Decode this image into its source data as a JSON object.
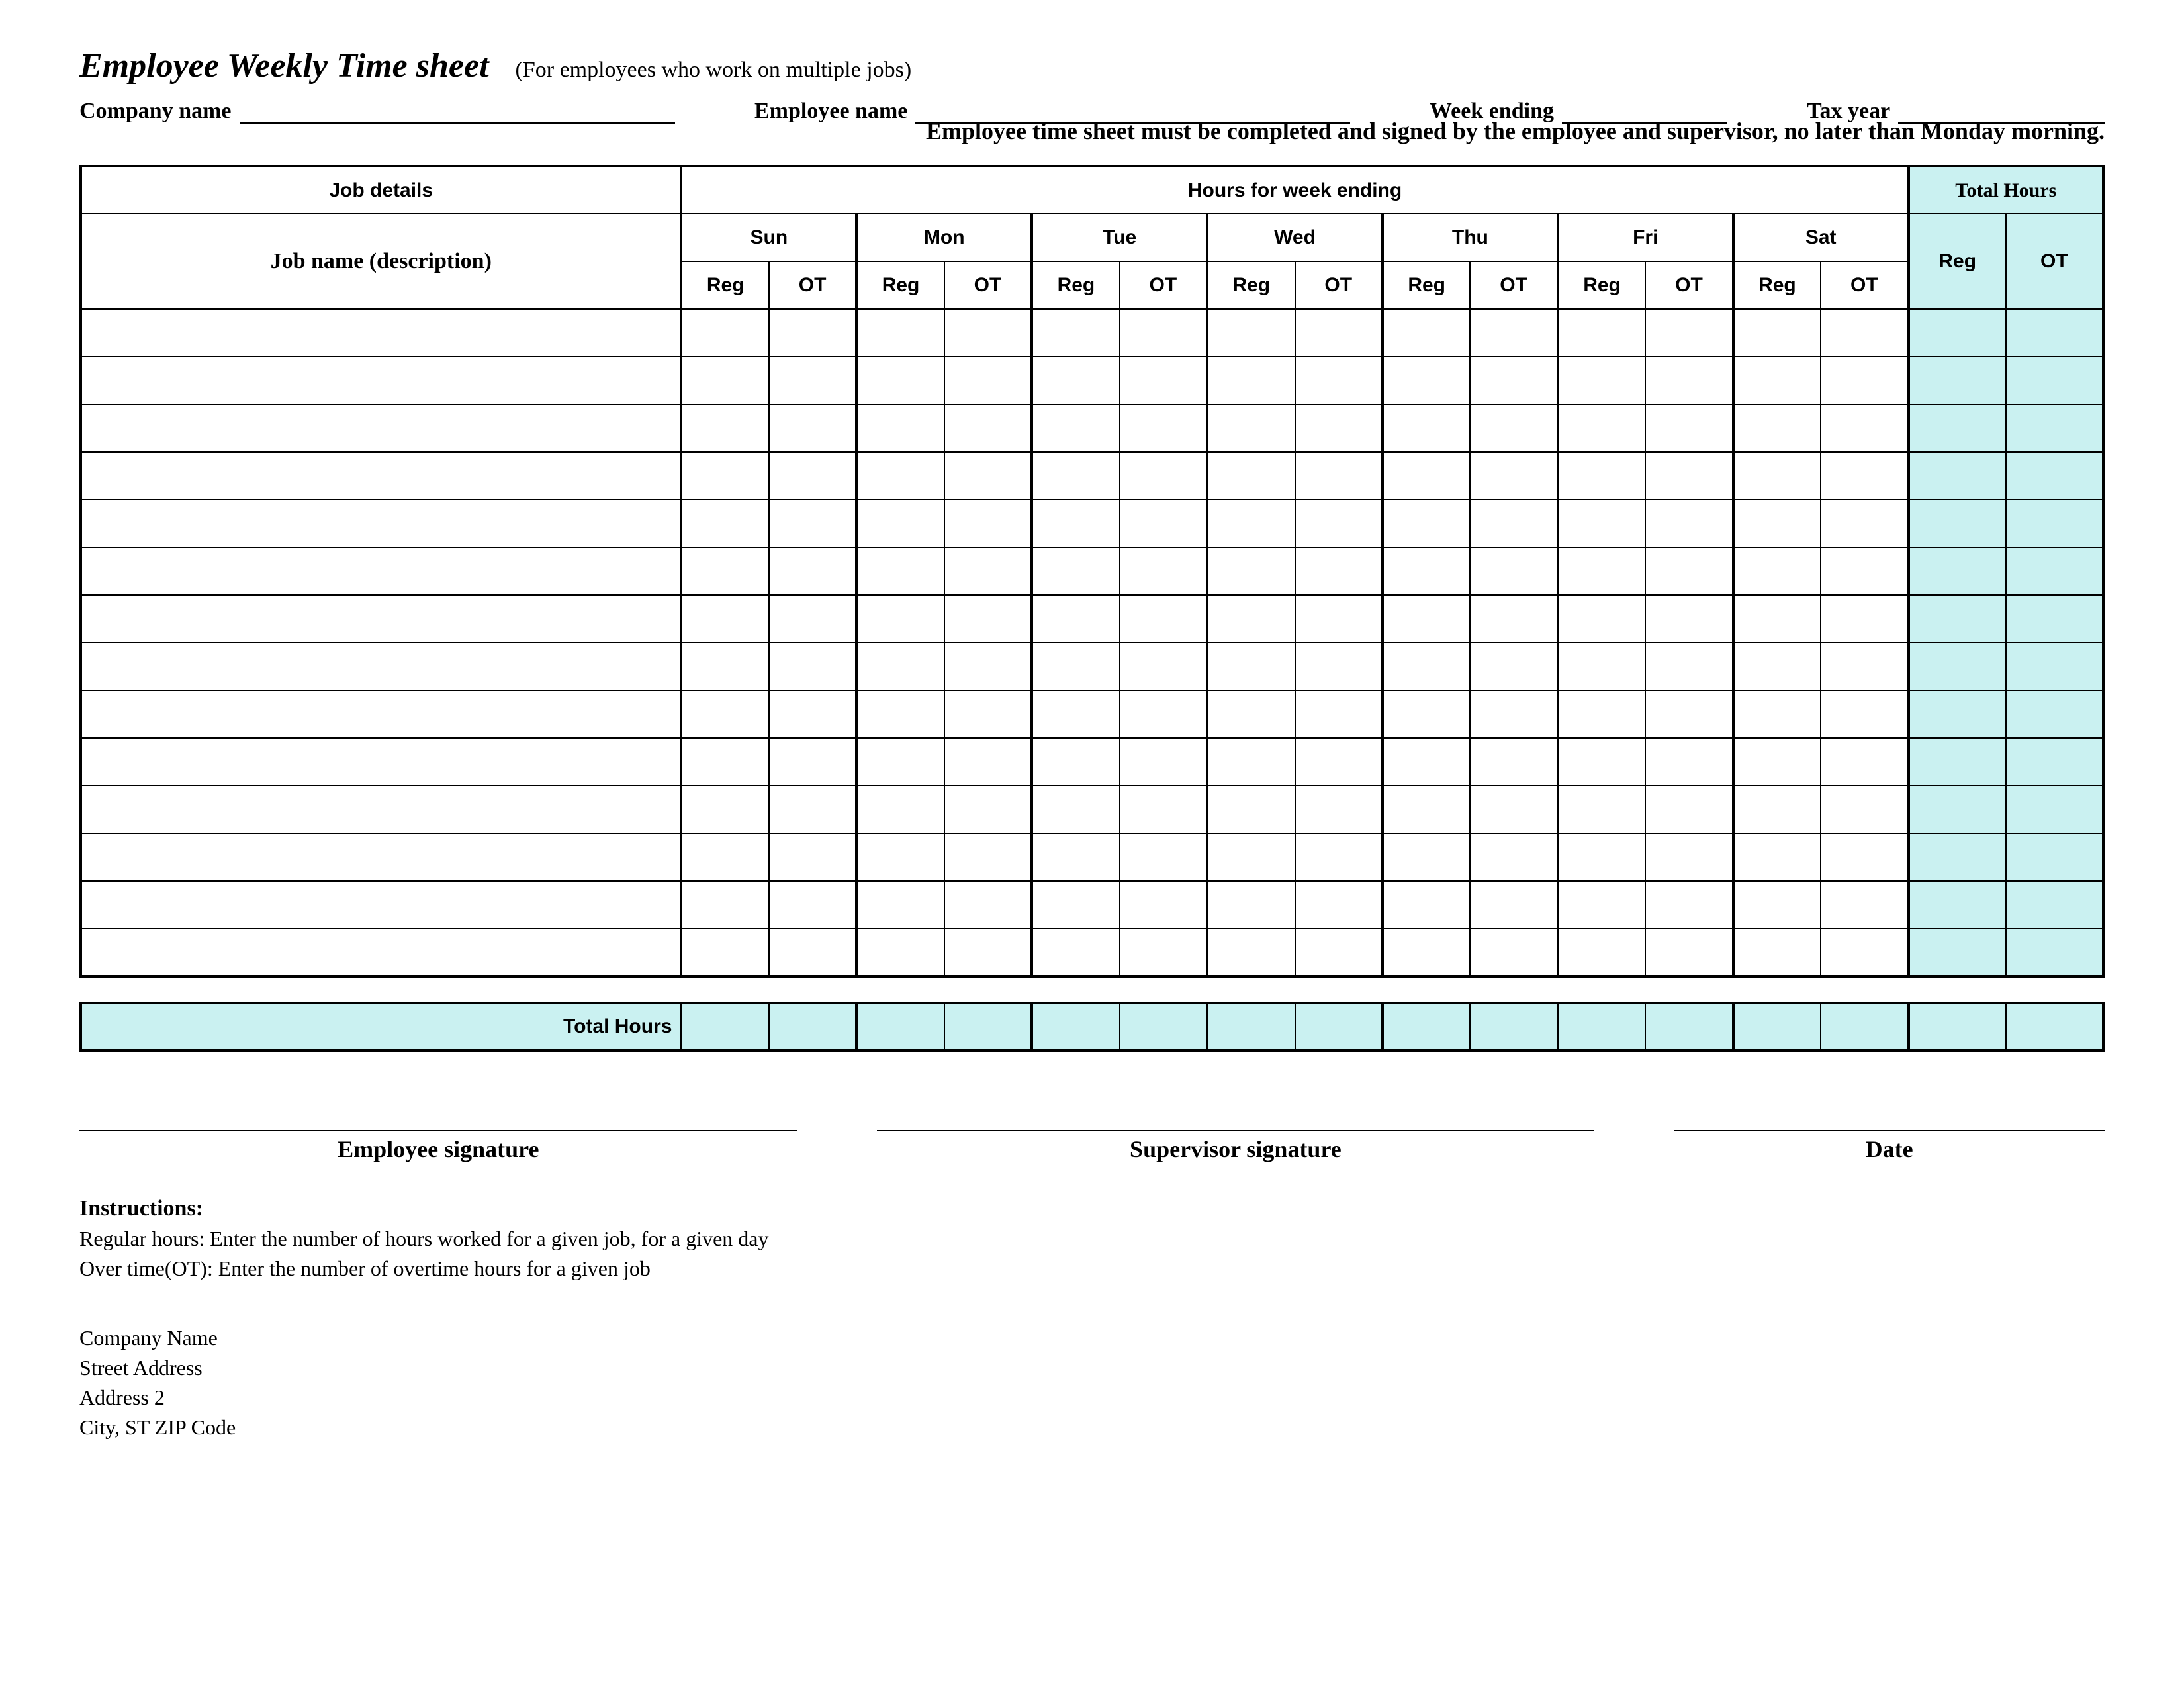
{
  "header": {
    "title": "Employee Weekly Time sheet",
    "subtitle": "(For employees who work on multiple jobs)",
    "company_label": "Company name",
    "employee_label": "Employee name",
    "week_ending_label": "Week ending",
    "tax_year_label": "Tax year",
    "bold_note": "Employee time sheet must be completed and signed by the employee and supervisor, no later than Monday morning."
  },
  "table": {
    "job_details_header": "Job details",
    "hours_for_week_header": "Hours for week ending",
    "total_hours_header": "Total Hours",
    "job_description_header": "Job name (description)",
    "reg_label": "Reg",
    "ot_label": "OT",
    "total_hours_row_label": "Total Hours",
    "days": [
      "Sun",
      "Mon",
      "Tue",
      "Wed",
      "Thu",
      "Fri",
      "Sat"
    ],
    "rows": [
      {
        "job": "",
        "cells": [
          "",
          "",
          "",
          "",
          "",
          "",
          "",
          "",
          "",
          "",
          "",
          "",
          "",
          ""
        ],
        "total_reg": "",
        "total_ot": ""
      },
      {
        "job": "",
        "cells": [
          "",
          "",
          "",
          "",
          "",
          "",
          "",
          "",
          "",
          "",
          "",
          "",
          "",
          ""
        ],
        "total_reg": "",
        "total_ot": ""
      },
      {
        "job": "",
        "cells": [
          "",
          "",
          "",
          "",
          "",
          "",
          "",
          "",
          "",
          "",
          "",
          "",
          "",
          ""
        ],
        "total_reg": "",
        "total_ot": ""
      },
      {
        "job": "",
        "cells": [
          "",
          "",
          "",
          "",
          "",
          "",
          "",
          "",
          "",
          "",
          "",
          "",
          "",
          ""
        ],
        "total_reg": "",
        "total_ot": ""
      },
      {
        "job": "",
        "cells": [
          "",
          "",
          "",
          "",
          "",
          "",
          "",
          "",
          "",
          "",
          "",
          "",
          "",
          ""
        ],
        "total_reg": "",
        "total_ot": ""
      },
      {
        "job": "",
        "cells": [
          "",
          "",
          "",
          "",
          "",
          "",
          "",
          "",
          "",
          "",
          "",
          "",
          "",
          ""
        ],
        "total_reg": "",
        "total_ot": ""
      },
      {
        "job": "",
        "cells": [
          "",
          "",
          "",
          "",
          "",
          "",
          "",
          "",
          "",
          "",
          "",
          "",
          "",
          ""
        ],
        "total_reg": "",
        "total_ot": ""
      },
      {
        "job": "",
        "cells": [
          "",
          "",
          "",
          "",
          "",
          "",
          "",
          "",
          "",
          "",
          "",
          "",
          "",
          ""
        ],
        "total_reg": "",
        "total_ot": ""
      },
      {
        "job": "",
        "cells": [
          "",
          "",
          "",
          "",
          "",
          "",
          "",
          "",
          "",
          "",
          "",
          "",
          "",
          ""
        ],
        "total_reg": "",
        "total_ot": ""
      },
      {
        "job": "",
        "cells": [
          "",
          "",
          "",
          "",
          "",
          "",
          "",
          "",
          "",
          "",
          "",
          "",
          "",
          ""
        ],
        "total_reg": "",
        "total_ot": ""
      },
      {
        "job": "",
        "cells": [
          "",
          "",
          "",
          "",
          "",
          "",
          "",
          "",
          "",
          "",
          "",
          "",
          "",
          ""
        ],
        "total_reg": "",
        "total_ot": ""
      },
      {
        "job": "",
        "cells": [
          "",
          "",
          "",
          "",
          "",
          "",
          "",
          "",
          "",
          "",
          "",
          "",
          "",
          ""
        ],
        "total_reg": "",
        "total_ot": ""
      },
      {
        "job": "",
        "cells": [
          "",
          "",
          "",
          "",
          "",
          "",
          "",
          "",
          "",
          "",
          "",
          "",
          "",
          ""
        ],
        "total_reg": "",
        "total_ot": ""
      },
      {
        "job": "",
        "cells": [
          "",
          "",
          "",
          "",
          "",
          "",
          "",
          "",
          "",
          "",
          "",
          "",
          "",
          ""
        ],
        "total_reg": "",
        "total_ot": ""
      }
    ],
    "footer_totals": [
      "",
      "",
      "",
      "",
      "",
      "",
      "",
      "",
      "",
      "",
      "",
      "",
      "",
      "",
      "",
      ""
    ]
  },
  "footer": {
    "sig_employee": "Employee signature",
    "sig_supervisor": "Supervisor signature",
    "sig_date": "Date",
    "instructions_title": "Instructions:",
    "instructions_1": "Regular hours: Enter the number of hours worked for a given job, for a given day",
    "instructions_2": "Over time(OT): Enter the number of overtime hours for a given job",
    "company_name_line": "Company Name",
    "street_line": "Street Address",
    "address2_line": "Address 2",
    "csz_line": "City, ST  ZIP Code"
  }
}
